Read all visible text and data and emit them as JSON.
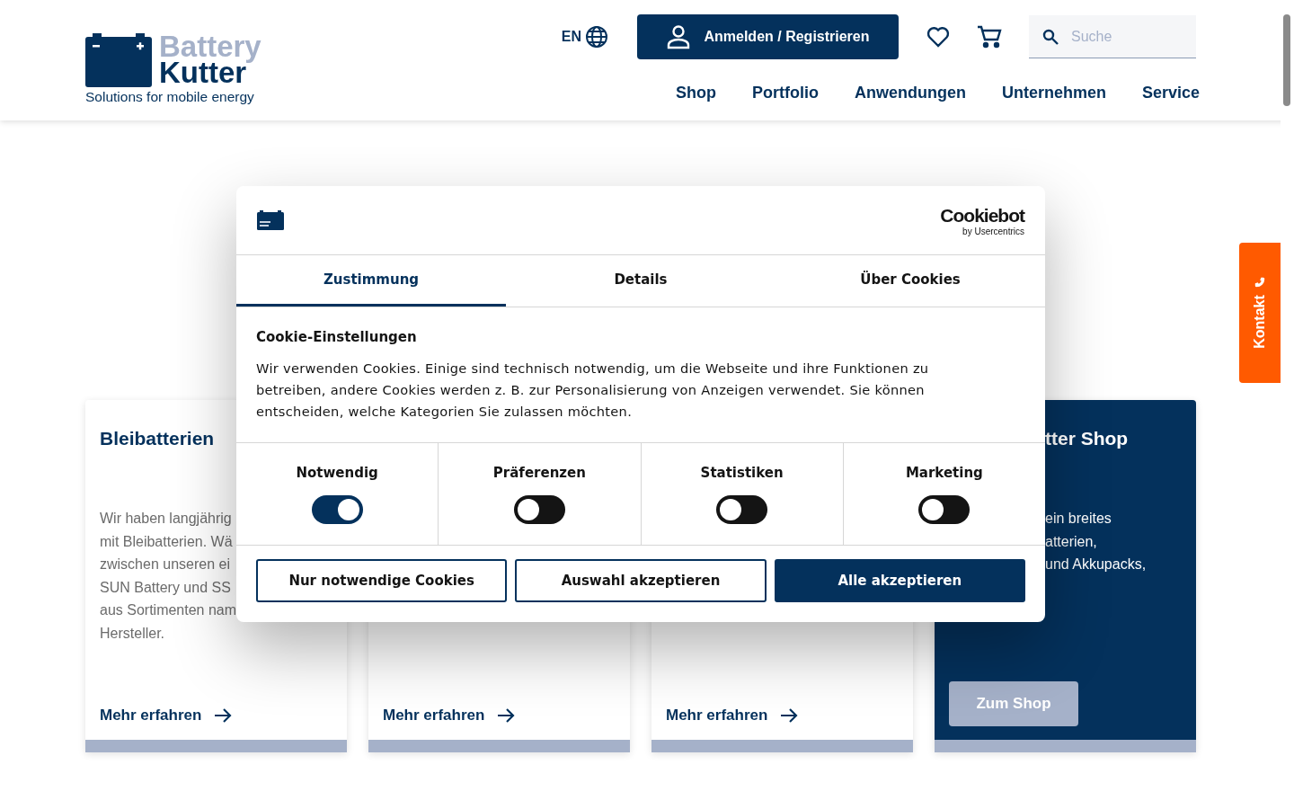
{
  "header": {
    "logo": {
      "line1": "Battery",
      "line2": "Kutter",
      "tagline": "Solutions for mobile energy"
    },
    "language": "EN",
    "login_button": "Anmelden / Registrieren",
    "search": {
      "placeholder": "Suche"
    },
    "nav": [
      "Shop",
      "Portfolio",
      "Anwendungen",
      "Unternehmen",
      "Service"
    ]
  },
  "cards": [
    {
      "kind": "light",
      "title": "Bleibatterien",
      "lines": [
        "Wir haben langjährig",
        "mit Bleibatterien. Wä",
        "zwischen unseren ei",
        "SUN Battery und SS",
        "aus Sortimenten nam",
        "Hersteller."
      ],
      "link": "Mehr erfahren"
    },
    {
      "kind": "light",
      "link": "Mehr erfahren"
    },
    {
      "kind": "light",
      "link": "Mehr erfahren"
    },
    {
      "kind": "dark",
      "title": "tter Shop",
      "lines": [
        "ein breites",
        "atterien,",
        "und Akkupacks,"
      ],
      "button": "Zum Shop"
    }
  ],
  "contact_tab": "Kontakt",
  "cookie_dialog": {
    "brand": {
      "name": "Cookiebot",
      "byline": "by Usercentrics"
    },
    "tabs": [
      {
        "label": "Zustimmung",
        "selected": true
      },
      {
        "label": "Details",
        "selected": false
      },
      {
        "label": "Über Cookies",
        "selected": false
      }
    ],
    "heading": "Cookie-Einstellungen",
    "text": "Wir verwenden Cookies. Einige sind technisch notwendig, um die Webseite und ihre Funktionen zu betreiben, andere Cookies werden z. B. zur Personalisierung von Anzeigen verwendet. Sie können entscheiden, welche Kategorien Sie zulassen möchten.",
    "categories": [
      {
        "label": "Notwendig",
        "on": true
      },
      {
        "label": "Präferenzen",
        "on": false
      },
      {
        "label": "Statistiken",
        "on": false
      },
      {
        "label": "Marketing",
        "on": false
      }
    ],
    "buttons": [
      {
        "kind": "outline",
        "label": "Nur notwendige Cookies"
      },
      {
        "kind": "outline",
        "label": "Auswahl akzeptieren"
      },
      {
        "kind": "filled",
        "label": "Alle akzeptieren"
      }
    ]
  }
}
